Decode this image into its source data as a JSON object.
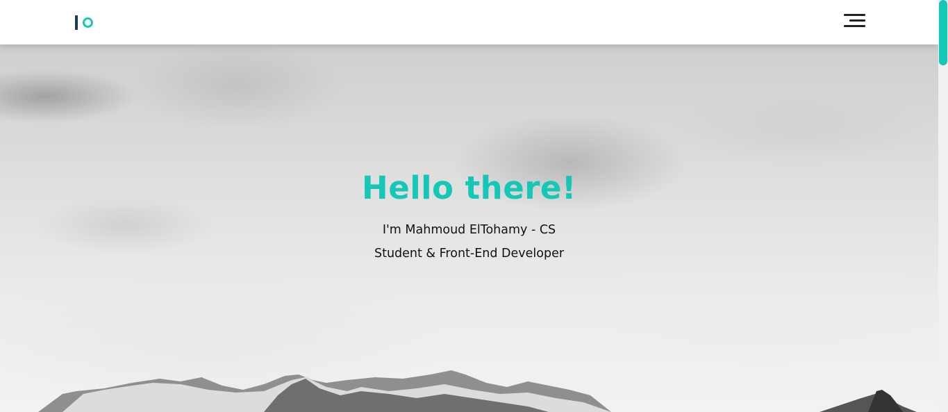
{
  "header": {
    "logo": {
      "name": "IO logo"
    },
    "menu_icon": "hamburger-menu-icon"
  },
  "hero": {
    "title": "Hello there!",
    "subtitle": "I'm Mahmoud ElTohamy - CS Student & Front-End Developer",
    "background": "grayscale cloudy sky with snowy mountains"
  },
  "colors": {
    "accent": "#14c7b7",
    "logo_bar": "#1f3b48",
    "text": "#111111",
    "header_bg": "#ffffff"
  },
  "scrollbar": {
    "thumb_color": "#14c7b7"
  }
}
